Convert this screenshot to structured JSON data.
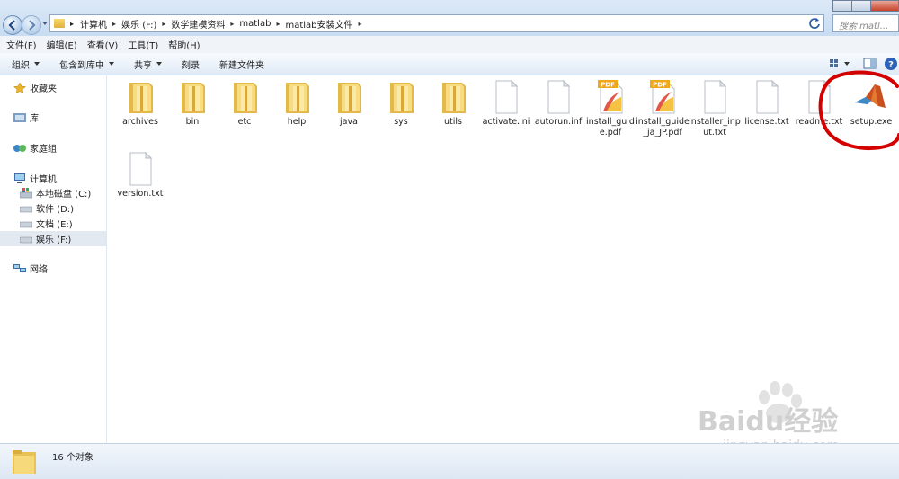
{
  "address": {
    "crumbs": [
      "计算机",
      "娱乐 (F:)",
      "数学建模资料",
      "matlab",
      "matlab安装文件"
    ],
    "search_placeholder": "搜索 matl..."
  },
  "menu": [
    "文件(F)",
    "编辑(E)",
    "查看(V)",
    "工具(T)",
    "帮助(H)"
  ],
  "toolbar": {
    "organize": "组织",
    "include_in_library": "包含到库中",
    "share": "共享",
    "burn": "刻录",
    "new_folder": "新建文件夹"
  },
  "sidebar": {
    "favorites": "收藏夹",
    "library": "库",
    "homegroup": "家庭组",
    "computer": "计算机",
    "drives": [
      "本地磁盘 (C:)",
      "软件 (D:)",
      "文档 (E:)",
      "娱乐 (F:)"
    ],
    "network": "网络"
  },
  "files": [
    {
      "label": "archives",
      "icon": "folder-icon"
    },
    {
      "label": "bin",
      "icon": "folder-icon"
    },
    {
      "label": "etc",
      "icon": "folder-icon"
    },
    {
      "label": "help",
      "icon": "folder-icon"
    },
    {
      "label": "java",
      "icon": "folder-icon"
    },
    {
      "label": "sys",
      "icon": "folder-icon"
    },
    {
      "label": "utils",
      "icon": "folder-icon"
    },
    {
      "label": "activate.ini",
      "icon": "file-icon"
    },
    {
      "label": "autorun.inf",
      "icon": "file-icon"
    },
    {
      "label": "install_guide.pdf",
      "icon": "pdf-icon"
    },
    {
      "label": "install_guide_ja_JP.pdf",
      "icon": "pdf-icon"
    },
    {
      "label": "installer_input.txt",
      "icon": "file-icon"
    },
    {
      "label": "license.txt",
      "icon": "file-icon"
    },
    {
      "label": "readme.txt",
      "icon": "file-icon"
    },
    {
      "label": "setup.exe",
      "icon": "matlab-icon"
    },
    {
      "label": "version.txt",
      "icon": "file-icon"
    }
  ],
  "pdf_badge": "PDF",
  "status": {
    "count": "16 个对象"
  },
  "watermark": {
    "brand": "Baidu经验",
    "url": "jingyan.baidu.com"
  },
  "colors": {
    "highlight_circle": "#d40000",
    "selection": "#e3e9f1"
  }
}
